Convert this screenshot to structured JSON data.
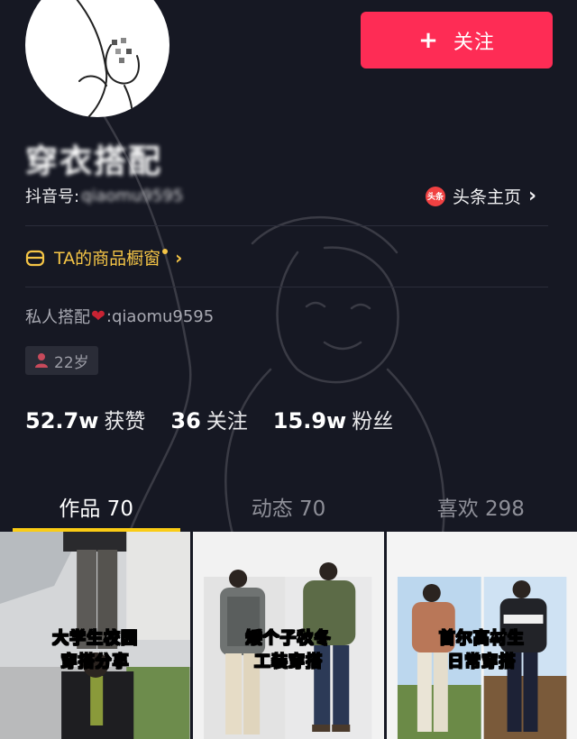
{
  "follow_label": "关注",
  "profile": {
    "nickname": "穿衣搭配",
    "douyin_id_label": "抖音号:",
    "douyin_id_value": "qiaomu9595",
    "toutiao_label": "头条主页",
    "toutiao_icon_text": "头条",
    "shop_label": "TA的商品橱窗",
    "bio_prefix": "私人搭配",
    "bio_suffix": ":qiaomu9595",
    "age": "22岁"
  },
  "stats": {
    "likes_num": "52.7w",
    "likes_label": "获赞",
    "following_num": "36",
    "following_label": "关注",
    "fans_num": "15.9w",
    "fans_label": "粉丝"
  },
  "tabs": [
    {
      "label": "作品 70"
    },
    {
      "label": "动态 70"
    },
    {
      "label": "喜欢 298"
    }
  ],
  "videos": [
    {
      "line1": "大学生校园",
      "line2": "穿搭分享"
    },
    {
      "line1": "矮个子秋冬",
      "line2": "工装穿搭"
    },
    {
      "line1": "首尔高材生",
      "line2": "日常穿搭"
    }
  ],
  "icons": [
    "plus-icon",
    "toutiao-icon",
    "chevron-right-icon",
    "shop-icon",
    "heart-icon",
    "person-icon"
  ],
  "colors": {
    "accent_red": "#fe2c55",
    "shop_yellow": "#f5c546",
    "tab_underline": "#facc15",
    "background": "#161823"
  }
}
